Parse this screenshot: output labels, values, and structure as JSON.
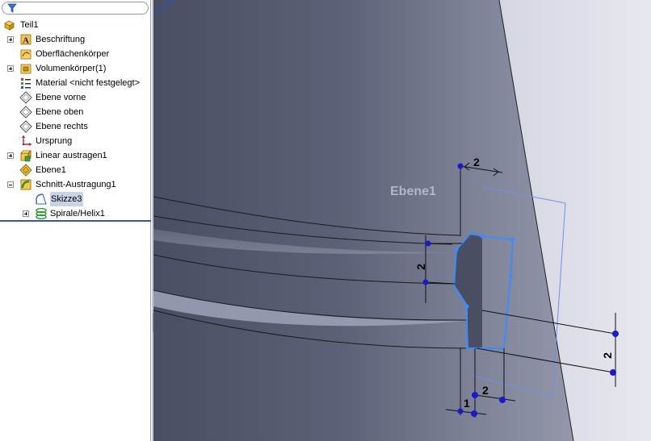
{
  "feature_tree": {
    "root": "Teil1",
    "items": [
      {
        "label": "Beschriftung",
        "icon": "annotation-icon"
      },
      {
        "label": "Oberflächenkörper",
        "icon": "surface-bodies-icon"
      },
      {
        "label": "Volumenkörper(1)",
        "icon": "solid-bodies-icon"
      },
      {
        "label": "Material <nicht festgelegt>",
        "icon": "material-icon"
      },
      {
        "label": "Ebene vorne",
        "icon": "plane-icon"
      },
      {
        "label": "Ebene oben",
        "icon": "plane-icon"
      },
      {
        "label": "Ebene rechts",
        "icon": "plane-icon"
      },
      {
        "label": "Ursprung",
        "icon": "origin-icon"
      },
      {
        "label": "Linear austragen1",
        "icon": "extrude-icon"
      },
      {
        "label": "Ebene1",
        "icon": "plane-icon"
      },
      {
        "label": "Schnitt-Austragung1",
        "icon": "swept-cut-icon"
      },
      {
        "label": "Skizze3",
        "icon": "sketch-icon"
      },
      {
        "label": "Spirale/Helix1",
        "icon": "helix-icon"
      }
    ]
  },
  "viewport": {
    "plane_label": "Ebene1",
    "dimensions": [
      "2",
      "2",
      "2",
      "2",
      "1"
    ],
    "colors": {
      "sketch": "#3b8cff",
      "dimension": "#000000",
      "point": "#1a1acc"
    }
  }
}
